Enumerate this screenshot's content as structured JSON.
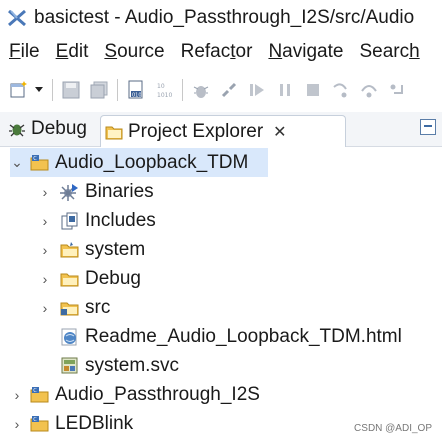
{
  "window": {
    "title": "basictest - Audio_Passthrough_I2S/src/Audio"
  },
  "menubar": {
    "items": [
      {
        "accel": "F",
        "rest": "ile"
      },
      {
        "accel": "E",
        "rest": "dit"
      },
      {
        "accel": "S",
        "rest": "ource"
      },
      {
        "pre": "Refac",
        "accel": "t",
        "rest": "or"
      },
      {
        "accel": "N",
        "rest": "avigate"
      },
      {
        "pre": "Searc",
        "accel": "h",
        "rest": ""
      }
    ]
  },
  "tabs": {
    "debug": "Debug",
    "project_explorer": "Project Explorer",
    "close_glyph": "✕"
  },
  "tree": {
    "project1": "Audio_Loopback_TDM",
    "children": [
      "Binaries",
      "Includes",
      "system",
      "Debug",
      "src",
      "Readme_Audio_Loopback_TDM.html",
      "system.svc"
    ],
    "project2": "Audio_Passthrough_I2S",
    "project3": "LEDBlink"
  },
  "watermark": "CSDN @ADI_OP",
  "colors": {
    "selection": "#d9e8fb",
    "folder": "#f2c24f",
    "accent": "#3d6aa2"
  }
}
